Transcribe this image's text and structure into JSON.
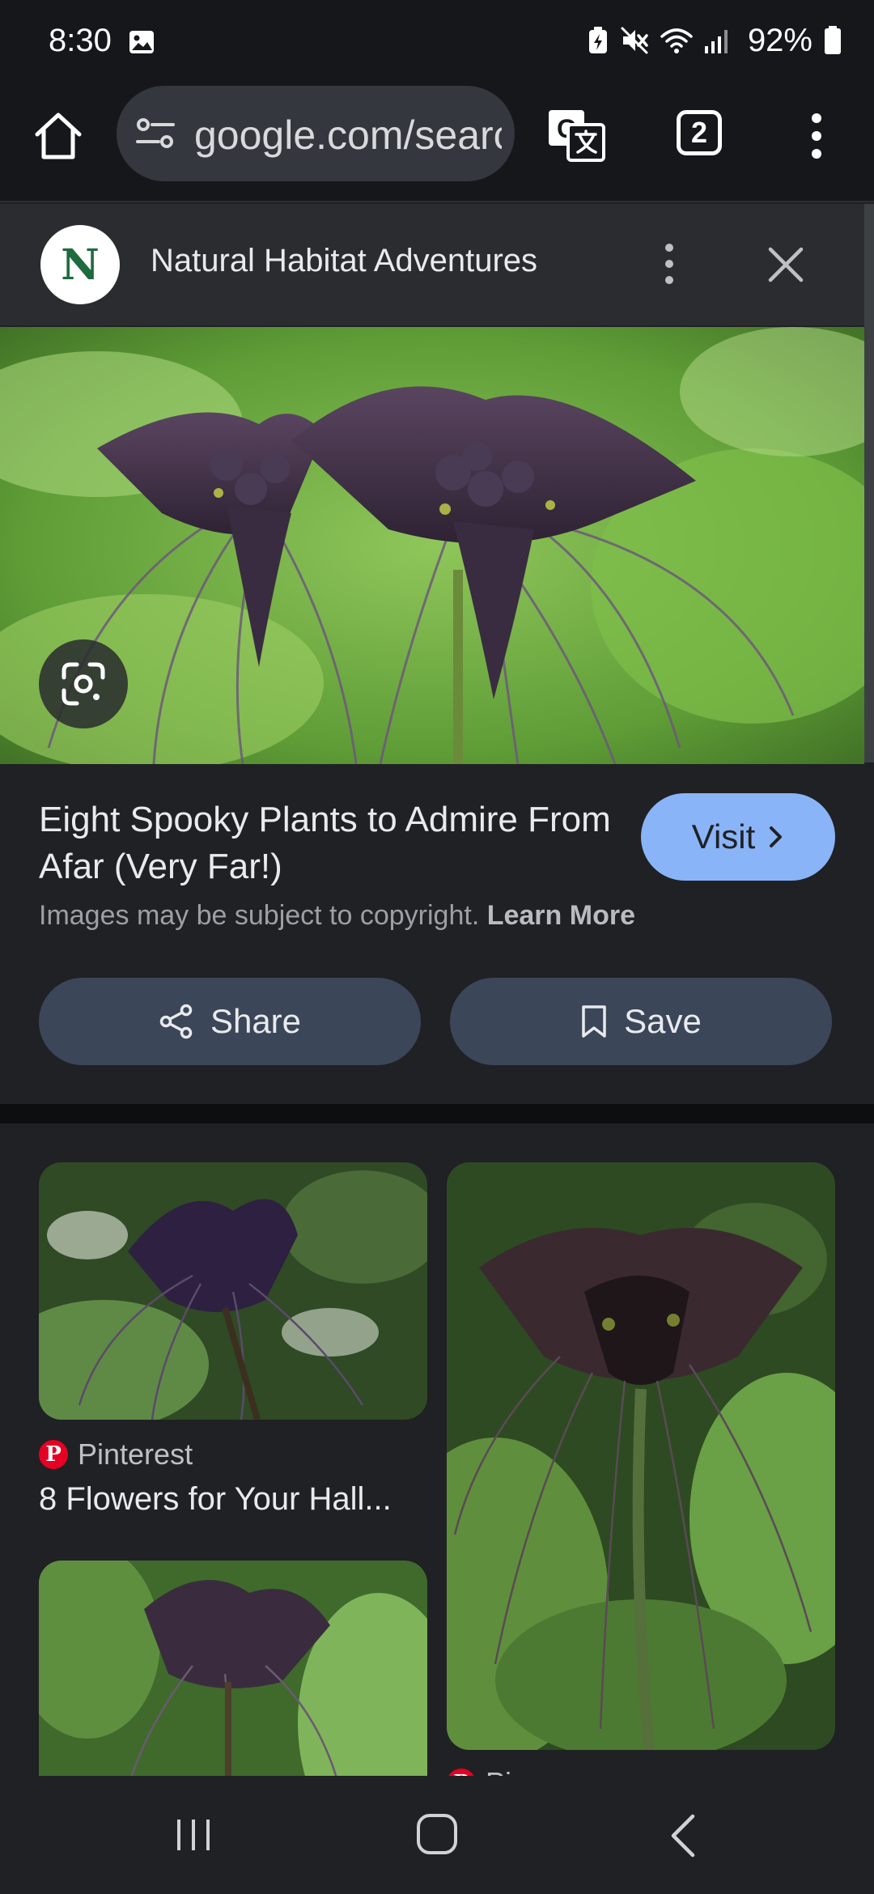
{
  "status_bar": {
    "time": "8:30",
    "battery_percent": "92%",
    "icons": [
      "image-icon",
      "battery-saver-icon",
      "mute-icon",
      "wifi-icon",
      "signal-icon",
      "battery-icon"
    ]
  },
  "browser": {
    "url": "google.com/search",
    "tab_count": "2",
    "icons": [
      "home-icon",
      "tune-icon",
      "translate-icon",
      "tabs-icon",
      "more-vert-icon"
    ]
  },
  "panel": {
    "source_name": "Natural Habitat Adventures",
    "source_logo_letter": "N",
    "title": "Eight Spooky Plants to Admire From Afar (Very Far!)",
    "visit_label": "Visit",
    "copyright_text": "Images may be subject to copyright.",
    "learn_more_label": "Learn More",
    "share_label": "Share",
    "save_label": "Save"
  },
  "related": {
    "items": [
      {
        "source": "Pinterest",
        "title": "8 Flowers for Your Hall..."
      },
      {
        "source": "Pin page",
        "title": ""
      }
    ]
  },
  "colors": {
    "accent": "#8ab4f8",
    "background": "#202124",
    "action_button": "#3c4659"
  }
}
